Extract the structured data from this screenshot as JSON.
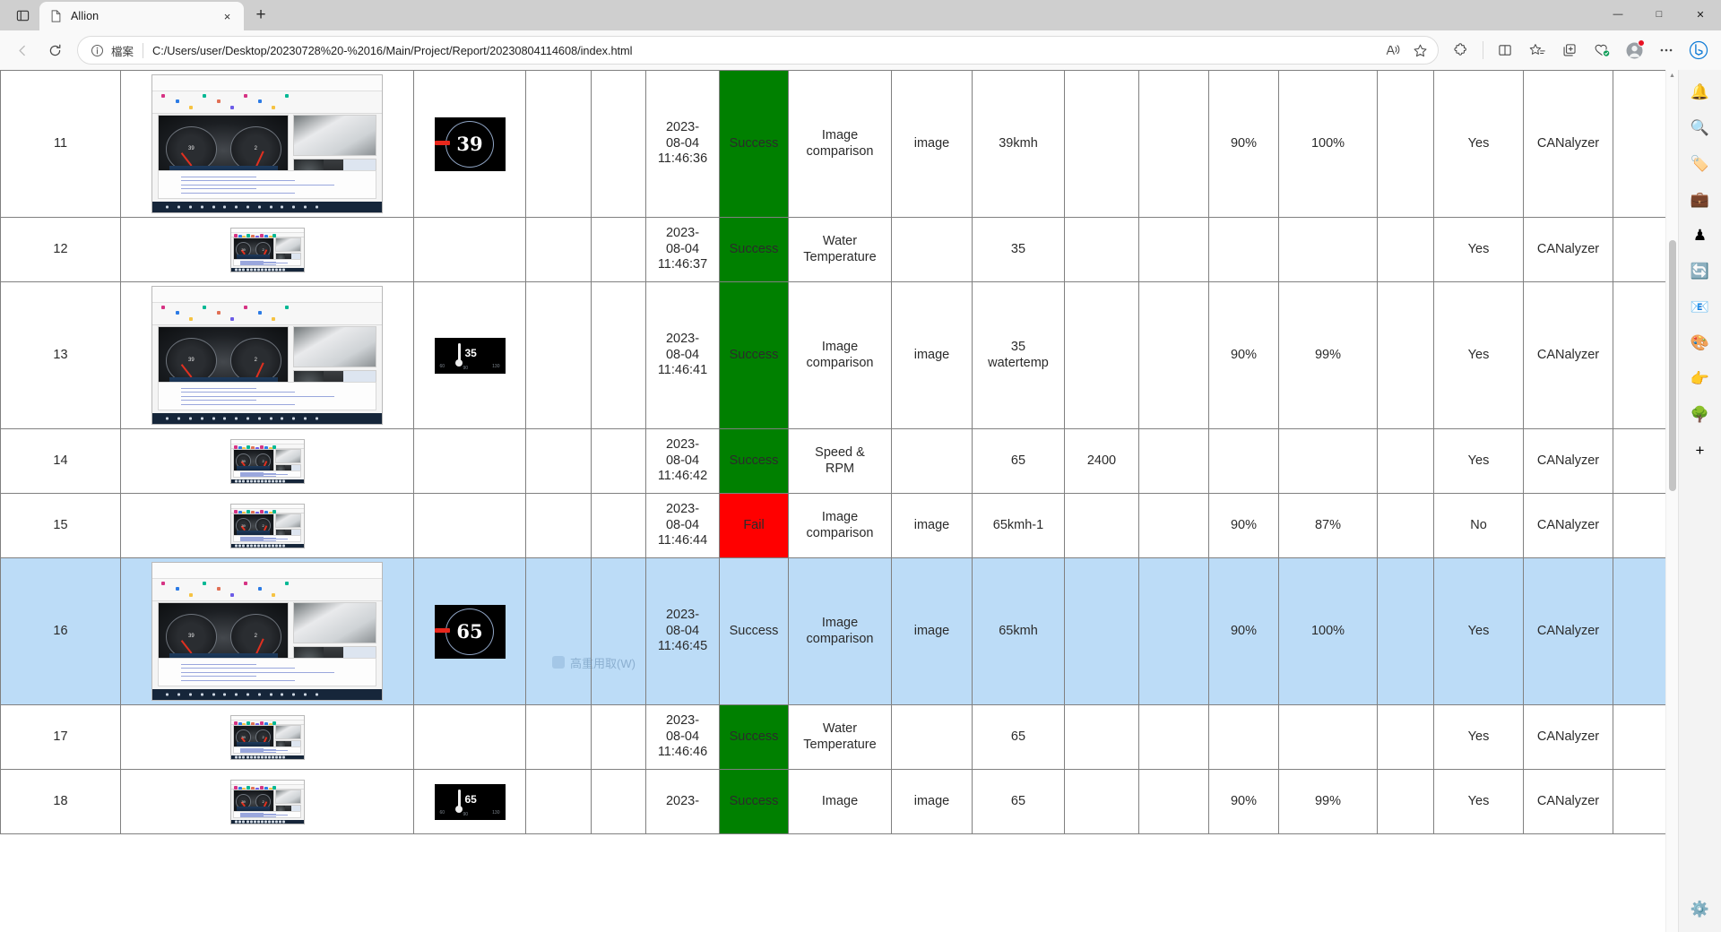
{
  "browser": {
    "tab": {
      "title": "Allion",
      "favicon": "page-icon",
      "close": "×"
    },
    "new_tab_label": "+",
    "window_controls": {
      "minimize": "—",
      "maximize": "□",
      "close": "✕"
    },
    "nav": {
      "back": "←",
      "forward": "→",
      "refresh": "⟳"
    },
    "omnibox": {
      "scheme_label": "檔案",
      "url": "C:/Users/user/Desktop/20230728%20-%2016/Main/Project/Report/20230804114608/index.html",
      "read_aloud": "read-aloud",
      "favorite": "add-favorite"
    },
    "toolbar_icons": [
      "extensions",
      "split-screen",
      "favorites",
      "collections",
      "browser-essentials",
      "profile",
      "settings-and-more",
      "copilot"
    ],
    "sidebar_icons": [
      "notifications-bell",
      "search",
      "price-tag",
      "shopping-tools",
      "games",
      "microsoft-365",
      "outlook",
      "image-creator",
      "telegram",
      "tree",
      "add-tool",
      "settings"
    ]
  },
  "table": {
    "rows": [
      {
        "index": "11",
        "screenshot": "full",
        "gauge": {
          "kind": "speed",
          "value": "39"
        },
        "empty1": "",
        "empty2": "",
        "time": "2023-\n08-04\n11:46:36",
        "status": "Success",
        "status_kind": "success",
        "type": "Image\ncomparison",
        "mode": "image",
        "value": "39kmh",
        "rpm": "",
        "empty3": "",
        "threshold": "90%",
        "score": "100%",
        "empty4": "",
        "pass": "Yes",
        "tool": "CANalyzer",
        "empty5": "",
        "selected": false
      },
      {
        "index": "12",
        "screenshot": "small",
        "gauge": null,
        "empty1": "",
        "empty2": "",
        "time": "2023-\n08-04\n11:46:37",
        "status": "Success",
        "status_kind": "success",
        "type": "Water\nTemperature",
        "mode": "",
        "value": "35",
        "rpm": "",
        "empty3": "",
        "threshold": "",
        "score": "",
        "empty4": "",
        "pass": "Yes",
        "tool": "CANalyzer",
        "empty5": "",
        "selected": false
      },
      {
        "index": "13",
        "screenshot": "full",
        "gauge": {
          "kind": "temp",
          "value": "35"
        },
        "empty1": "",
        "empty2": "",
        "time": "2023-\n08-04\n11:46:41",
        "status": "Success",
        "status_kind": "success",
        "type": "Image\ncomparison",
        "mode": "image",
        "value": "35\nwatertemp",
        "rpm": "",
        "empty3": "",
        "threshold": "90%",
        "score": "99%",
        "empty4": "",
        "pass": "Yes",
        "tool": "CANalyzer",
        "empty5": "",
        "selected": false
      },
      {
        "index": "14",
        "screenshot": "small",
        "gauge": null,
        "empty1": "",
        "empty2": "",
        "time": "2023-\n08-04\n11:46:42",
        "status": "Success",
        "status_kind": "success",
        "type": "Speed &\nRPM",
        "mode": "",
        "value": "65",
        "rpm": "2400",
        "empty3": "",
        "threshold": "",
        "score": "",
        "empty4": "",
        "pass": "Yes",
        "tool": "CANalyzer",
        "empty5": "",
        "selected": false
      },
      {
        "index": "15",
        "screenshot": "small",
        "gauge": null,
        "empty1": "",
        "empty2": "",
        "time": "2023-\n08-04\n11:46:44",
        "status": "Fail",
        "status_kind": "fail",
        "type": "Image\ncomparison",
        "mode": "image",
        "value": "65kmh-1",
        "rpm": "",
        "empty3": "",
        "threshold": "90%",
        "score": "87%",
        "empty4": "",
        "pass": "No",
        "tool": "CANalyzer",
        "empty5": "",
        "selected": false
      },
      {
        "index": "16",
        "screenshot": "full",
        "gauge": {
          "kind": "speed",
          "value": "65"
        },
        "empty1": "",
        "empty2": "",
        "time": "2023-\n08-04\n11:46:45",
        "status": "Success",
        "status_kind": "success",
        "type": "Image\ncomparison",
        "mode": "image",
        "value": "65kmh",
        "rpm": "",
        "empty3": "",
        "threshold": "90%",
        "score": "100%",
        "empty4": "",
        "pass": "Yes",
        "tool": "CANalyzer",
        "empty5": "",
        "selected": true
      },
      {
        "index": "17",
        "screenshot": "small",
        "gauge": null,
        "empty1": "",
        "empty2": "",
        "time": "2023-\n08-04\n11:46:46",
        "status": "Success",
        "status_kind": "success",
        "type": "Water\nTemperature",
        "mode": "",
        "value": "65",
        "rpm": "",
        "empty3": "",
        "threshold": "",
        "score": "",
        "empty4": "",
        "pass": "Yes",
        "tool": "CANalyzer",
        "empty5": "",
        "selected": false
      },
      {
        "index": "18",
        "screenshot": "small",
        "gauge": {
          "kind": "temp",
          "value": "65"
        },
        "empty1": "",
        "empty2": "",
        "time": "2023-",
        "status": "Success",
        "status_kind": "success",
        "type": "Image",
        "mode": "image",
        "value": "65",
        "rpm": "",
        "empty3": "",
        "threshold": "90%",
        "score": "99%",
        "empty4": "",
        "pass": "Yes",
        "tool": "CANalyzer",
        "empty5": "",
        "selected": false
      }
    ]
  },
  "overlay": {
    "ghost_text": "高重用取(W)"
  }
}
